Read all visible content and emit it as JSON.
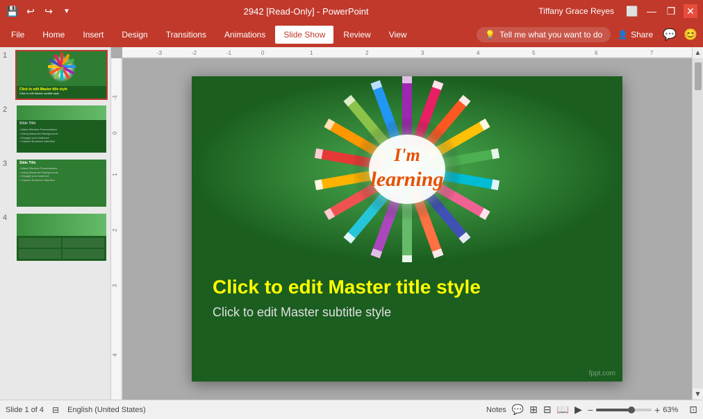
{
  "titlebar": {
    "title": "2942 [Read-Only] - PowerPoint",
    "user": "Tiffany Grace Reyes",
    "save_icon": "💾",
    "undo_icon": "↩",
    "redo_icon": "↪",
    "customize_icon": "▼",
    "minimize_icon": "—",
    "restore_icon": "❐",
    "close_icon": "✕"
  },
  "ribbon": {
    "tabs": [
      {
        "label": "File",
        "active": false
      },
      {
        "label": "Home",
        "active": false
      },
      {
        "label": "Insert",
        "active": false
      },
      {
        "label": "Design",
        "active": false
      },
      {
        "label": "Transitions",
        "active": false
      },
      {
        "label": "Animations",
        "active": false
      },
      {
        "label": "Slide Show",
        "active": true
      },
      {
        "label": "Review",
        "active": false
      },
      {
        "label": "View",
        "active": false
      }
    ],
    "tell_me": "Tell me what you want to do",
    "share_label": "Share"
  },
  "slides": [
    {
      "num": "1",
      "selected": true
    },
    {
      "num": "2",
      "selected": false
    },
    {
      "num": "3",
      "selected": false
    },
    {
      "num": "4",
      "selected": false
    }
  ],
  "main_slide": {
    "learning_im": "I'm",
    "learning_word": "learning",
    "master_title": "Click to edit Master title style",
    "master_subtitle": "Click to edit Master subtitle style",
    "watermark": "fppt.com"
  },
  "statusbar": {
    "slide_info": "Slide 1 of 4",
    "language": "English (United States)",
    "notes_label": "Notes",
    "zoom_percent": "63%"
  }
}
